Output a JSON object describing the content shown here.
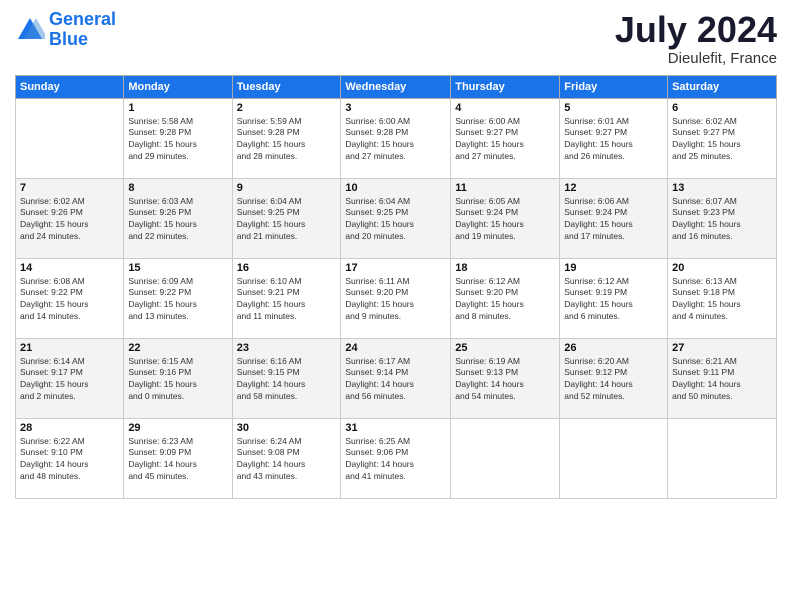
{
  "header": {
    "logo_line1": "General",
    "logo_line2": "Blue",
    "month": "July 2024",
    "location": "Dieulefit, France"
  },
  "columns": [
    "Sunday",
    "Monday",
    "Tuesday",
    "Wednesday",
    "Thursday",
    "Friday",
    "Saturday"
  ],
  "weeks": [
    [
      {
        "day": "",
        "info": ""
      },
      {
        "day": "1",
        "info": "Sunrise: 5:58 AM\nSunset: 9:28 PM\nDaylight: 15 hours\nand 29 minutes."
      },
      {
        "day": "2",
        "info": "Sunrise: 5:59 AM\nSunset: 9:28 PM\nDaylight: 15 hours\nand 28 minutes."
      },
      {
        "day": "3",
        "info": "Sunrise: 6:00 AM\nSunset: 9:28 PM\nDaylight: 15 hours\nand 27 minutes."
      },
      {
        "day": "4",
        "info": "Sunrise: 6:00 AM\nSunset: 9:27 PM\nDaylight: 15 hours\nand 27 minutes."
      },
      {
        "day": "5",
        "info": "Sunrise: 6:01 AM\nSunset: 9:27 PM\nDaylight: 15 hours\nand 26 minutes."
      },
      {
        "day": "6",
        "info": "Sunrise: 6:02 AM\nSunset: 9:27 PM\nDaylight: 15 hours\nand 25 minutes."
      }
    ],
    [
      {
        "day": "7",
        "info": "Sunrise: 6:02 AM\nSunset: 9:26 PM\nDaylight: 15 hours\nand 24 minutes."
      },
      {
        "day": "8",
        "info": "Sunrise: 6:03 AM\nSunset: 9:26 PM\nDaylight: 15 hours\nand 22 minutes."
      },
      {
        "day": "9",
        "info": "Sunrise: 6:04 AM\nSunset: 9:25 PM\nDaylight: 15 hours\nand 21 minutes."
      },
      {
        "day": "10",
        "info": "Sunrise: 6:04 AM\nSunset: 9:25 PM\nDaylight: 15 hours\nand 20 minutes."
      },
      {
        "day": "11",
        "info": "Sunrise: 6:05 AM\nSunset: 9:24 PM\nDaylight: 15 hours\nand 19 minutes."
      },
      {
        "day": "12",
        "info": "Sunrise: 6:06 AM\nSunset: 9:24 PM\nDaylight: 15 hours\nand 17 minutes."
      },
      {
        "day": "13",
        "info": "Sunrise: 6:07 AM\nSunset: 9:23 PM\nDaylight: 15 hours\nand 16 minutes."
      }
    ],
    [
      {
        "day": "14",
        "info": "Sunrise: 6:08 AM\nSunset: 9:22 PM\nDaylight: 15 hours\nand 14 minutes."
      },
      {
        "day": "15",
        "info": "Sunrise: 6:09 AM\nSunset: 9:22 PM\nDaylight: 15 hours\nand 13 minutes."
      },
      {
        "day": "16",
        "info": "Sunrise: 6:10 AM\nSunset: 9:21 PM\nDaylight: 15 hours\nand 11 minutes."
      },
      {
        "day": "17",
        "info": "Sunrise: 6:11 AM\nSunset: 9:20 PM\nDaylight: 15 hours\nand 9 minutes."
      },
      {
        "day": "18",
        "info": "Sunrise: 6:12 AM\nSunset: 9:20 PM\nDaylight: 15 hours\nand 8 minutes."
      },
      {
        "day": "19",
        "info": "Sunrise: 6:12 AM\nSunset: 9:19 PM\nDaylight: 15 hours\nand 6 minutes."
      },
      {
        "day": "20",
        "info": "Sunrise: 6:13 AM\nSunset: 9:18 PM\nDaylight: 15 hours\nand 4 minutes."
      }
    ],
    [
      {
        "day": "21",
        "info": "Sunrise: 6:14 AM\nSunset: 9:17 PM\nDaylight: 15 hours\nand 2 minutes."
      },
      {
        "day": "22",
        "info": "Sunrise: 6:15 AM\nSunset: 9:16 PM\nDaylight: 15 hours\nand 0 minutes."
      },
      {
        "day": "23",
        "info": "Sunrise: 6:16 AM\nSunset: 9:15 PM\nDaylight: 14 hours\nand 58 minutes."
      },
      {
        "day": "24",
        "info": "Sunrise: 6:17 AM\nSunset: 9:14 PM\nDaylight: 14 hours\nand 56 minutes."
      },
      {
        "day": "25",
        "info": "Sunrise: 6:19 AM\nSunset: 9:13 PM\nDaylight: 14 hours\nand 54 minutes."
      },
      {
        "day": "26",
        "info": "Sunrise: 6:20 AM\nSunset: 9:12 PM\nDaylight: 14 hours\nand 52 minutes."
      },
      {
        "day": "27",
        "info": "Sunrise: 6:21 AM\nSunset: 9:11 PM\nDaylight: 14 hours\nand 50 minutes."
      }
    ],
    [
      {
        "day": "28",
        "info": "Sunrise: 6:22 AM\nSunset: 9:10 PM\nDaylight: 14 hours\nand 48 minutes."
      },
      {
        "day": "29",
        "info": "Sunrise: 6:23 AM\nSunset: 9:09 PM\nDaylight: 14 hours\nand 45 minutes."
      },
      {
        "day": "30",
        "info": "Sunrise: 6:24 AM\nSunset: 9:08 PM\nDaylight: 14 hours\nand 43 minutes."
      },
      {
        "day": "31",
        "info": "Sunrise: 6:25 AM\nSunset: 9:06 PM\nDaylight: 14 hours\nand 41 minutes."
      },
      {
        "day": "",
        "info": ""
      },
      {
        "day": "",
        "info": ""
      },
      {
        "day": "",
        "info": ""
      }
    ]
  ]
}
